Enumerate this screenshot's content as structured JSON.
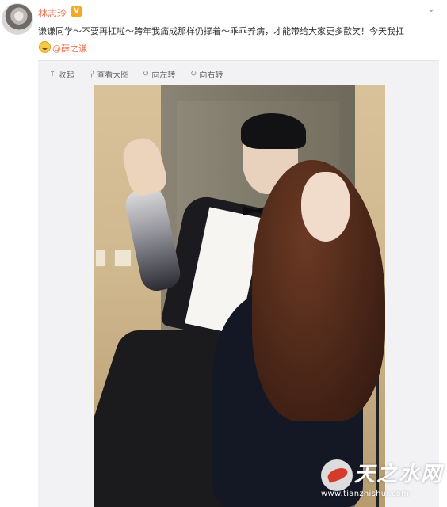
{
  "post": {
    "author": "林志玲",
    "verified_badge": "V",
    "text": "谦谦同学～不要再扛啦～跨年我痛成那样仍撑着～乖乖养病，才能带给大家更多歡笑！今天我扛",
    "mention": "@薛之谦"
  },
  "toolbar": {
    "collapse_label": "收起",
    "view_large_label": "查看大图",
    "rotate_left_label": "向左转",
    "rotate_right_label": "向右转"
  },
  "watermark": {
    "brand": "天之水网",
    "url": "www.tianzhishui.com"
  },
  "icons": {
    "collapse": "arrow-up-icon",
    "view_large": "search-icon",
    "rotate_left": "rotate-left-icon",
    "rotate_right": "rotate-right-icon",
    "menu": "chevron-down-icon"
  },
  "colors": {
    "username": "#eb7350",
    "mention": "#eb7350",
    "media_bg": "#f2f2f5"
  }
}
